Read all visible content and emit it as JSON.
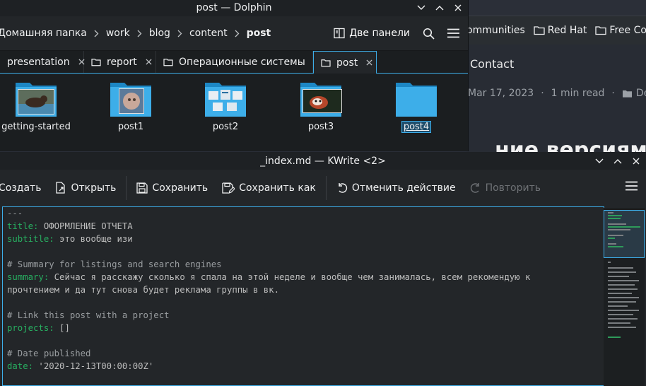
{
  "browser": {
    "bookmarks": [
      "ommunities",
      "Red Hat",
      "Free Conte"
    ],
    "nav_contact": "Contact",
    "post_date": "Mar 17, 2023",
    "dot": "·",
    "read_time": "1 min read",
    "category": "Dem",
    "heading": "ние версиями Git"
  },
  "dolphin": {
    "title": "post — Dolphin",
    "breadcrumbs": [
      "Домашняя папка",
      "work",
      "blog",
      "content",
      "post"
    ],
    "split_label": "Две панели",
    "tabs": [
      {
        "label": "presentation",
        "active": false
      },
      {
        "label": "report",
        "active": false
      },
      {
        "label": "Операционные системы",
        "active": false
      },
      {
        "label": "post",
        "active": true
      }
    ],
    "files": [
      {
        "name": "getting-started",
        "thumb": "otter"
      },
      {
        "name": "post1",
        "thumb": "cat"
      },
      {
        "name": "post2",
        "thumb": "windows"
      },
      {
        "name": "post3",
        "thumb": "redpanda"
      },
      {
        "name": "post4",
        "thumb": "none",
        "selected": true
      }
    ]
  },
  "kwrite": {
    "title": "_index.md — KWrite <2>",
    "toolbar": {
      "new": "Создать",
      "open": "Открыть",
      "save": "Сохранить",
      "save_as": "Сохранить как",
      "undo": "Отменить действие",
      "redo": "Повторить"
    },
    "lines": [
      {
        "parts": [
          {
            "t": "---",
            "c": "c"
          }
        ]
      },
      {
        "parts": [
          {
            "t": "title:",
            "c": "k"
          },
          {
            "t": " ОФОРМЛЕНИЕ ОТЧЕТА",
            "c": "s"
          }
        ]
      },
      {
        "parts": [
          {
            "t": "subtitle:",
            "c": "k"
          },
          {
            "t": " это вообще изи",
            "c": "s"
          }
        ]
      },
      {
        "parts": []
      },
      {
        "parts": [
          {
            "t": "# Summary for listings and search engines",
            "c": "c"
          }
        ]
      },
      {
        "parts": [
          {
            "t": "summary:",
            "c": "k"
          },
          {
            "t": " Сейчас я расскажу сколько я спала на этой неделе и вообще чем занималась, всем рекомендую к",
            "c": "s"
          }
        ]
      },
      {
        "parts": [
          {
            "t": "прочтением и да тут снова будет реклама группы в вк.",
            "c": "s"
          }
        ]
      },
      {
        "parts": []
      },
      {
        "parts": [
          {
            "t": "# Link this post with a project",
            "c": "c"
          }
        ]
      },
      {
        "parts": [
          {
            "t": "projects:",
            "c": "k"
          },
          {
            "t": " []",
            "c": "s"
          }
        ]
      },
      {
        "parts": []
      },
      {
        "parts": [
          {
            "t": "# Date published",
            "c": "c"
          }
        ]
      },
      {
        "parts": [
          {
            "t": "date:",
            "c": "k"
          },
          {
            "t": " '2020-12-13T00:00:00Z'",
            "c": "s"
          }
        ]
      },
      {
        "parts": []
      }
    ]
  },
  "colors": {
    "accent": "#3daee9",
    "folder": "#3daee9",
    "key": "#27ae60"
  }
}
